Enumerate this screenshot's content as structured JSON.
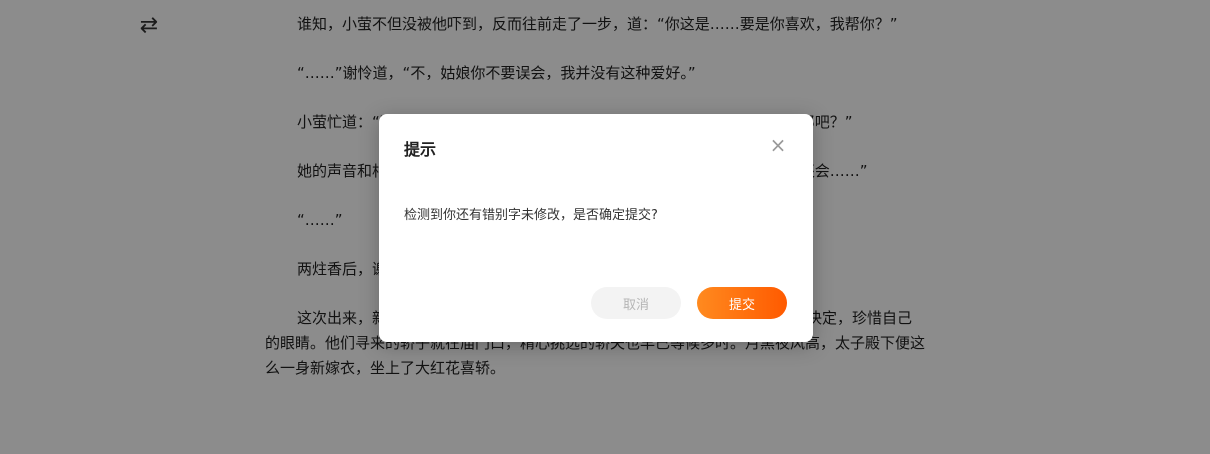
{
  "toolbar": {
    "swap_icon_glyph": "⇄"
  },
  "article": {
    "paragraphs": [
      "谁知，小萤不但没被他吓到，反而往前走了一步，道：“你这是……要是你喜欢，我帮你？”",
      "“……”谢怜道，“不，姑娘你不要误会，我并没有这种爱好。”",
      "小萤忙道：“不是的，我是说，我是想说，我可以帮忙……你们是要去抓鬼新郎吧？”",
      "她的声音和相貌一样，柔柔弱弱的：“我可以帮忙的，哪儿不好我可以改，我还会……”",
      "“……”",
      "两炷香后，谢怜再次低着头从殿后出来。",
      "这次出来，新娘的盖头已经盖好，南风和扶摇似乎本想跟上一趟，但最终还是决定，珍惜自己的眼睛。他们寻来的轿子就在庙门口，精心挑选的轿夫也早已等候多时。月黑夜风高，太子殿下便这么一身新嫁衣，坐上了大红花喜轿。"
    ]
  },
  "dialog": {
    "title": "提示",
    "close_glyph": "×",
    "message": "检测到你还有错别字未修改，是否确定提交?",
    "cancel_label": "取消",
    "submit_label": "提交"
  },
  "colors": {
    "accent_start": "#ff8a1f",
    "accent_end": "#ff5a00",
    "overlay": "rgba(0,0,0,0.45)"
  }
}
